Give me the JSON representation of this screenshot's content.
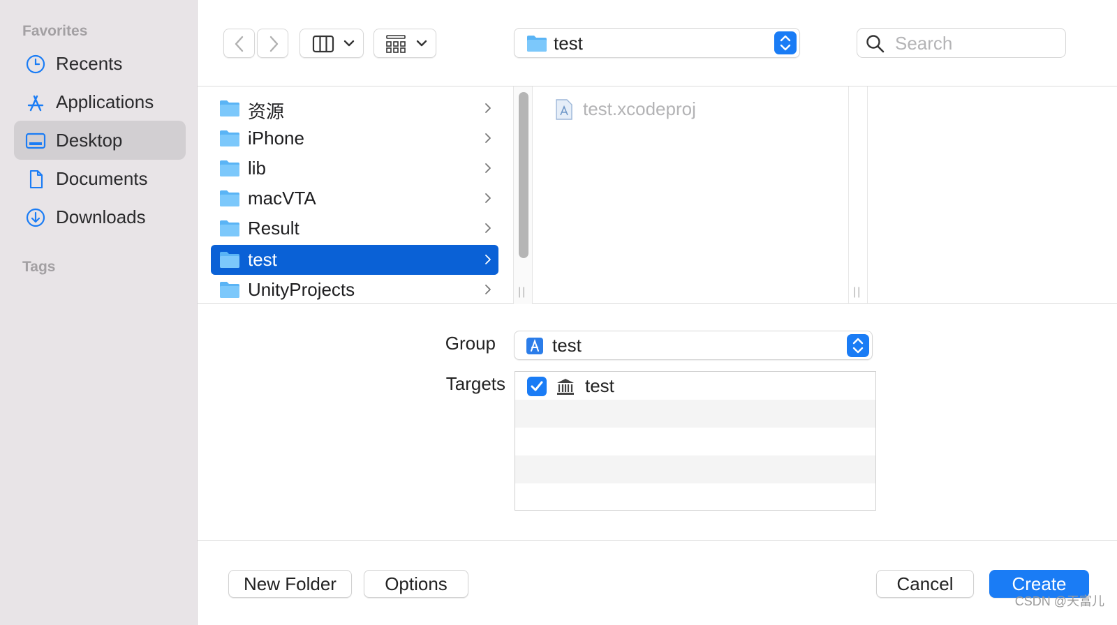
{
  "sidebar": {
    "favorites_heading": "Favorites",
    "tags_heading": "Tags",
    "items": [
      {
        "label": "Recents",
        "icon": "clock-icon"
      },
      {
        "label": "Applications",
        "icon": "applications-icon"
      },
      {
        "label": "Desktop",
        "icon": "desktop-icon",
        "selected": true
      },
      {
        "label": "Documents",
        "icon": "document-icon"
      },
      {
        "label": "Downloads",
        "icon": "download-icon"
      }
    ]
  },
  "toolbar": {
    "path_label": "test",
    "search_placeholder": "Search"
  },
  "browser": {
    "folders": [
      {
        "label": "资源"
      },
      {
        "label": "iPhone"
      },
      {
        "label": "lib"
      },
      {
        "label": "macVTA"
      },
      {
        "label": "Result"
      },
      {
        "label": "test",
        "selected": true
      },
      {
        "label": "UnityProjects"
      }
    ],
    "files": [
      {
        "label": "test.xcodeproj"
      }
    ]
  },
  "options": {
    "group_label": "Group",
    "group_value": "test",
    "targets_label": "Targets",
    "targets": [
      {
        "label": "test",
        "checked": true
      }
    ]
  },
  "buttons": {
    "new_folder": "New Folder",
    "options": "Options",
    "cancel": "Cancel",
    "create": "Create"
  },
  "watermark": "CSDN @天富儿",
  "colors": {
    "accent": "#1a7cf5",
    "selection": "#0a61d6",
    "sidebar_bg": "#e8e4e7"
  }
}
